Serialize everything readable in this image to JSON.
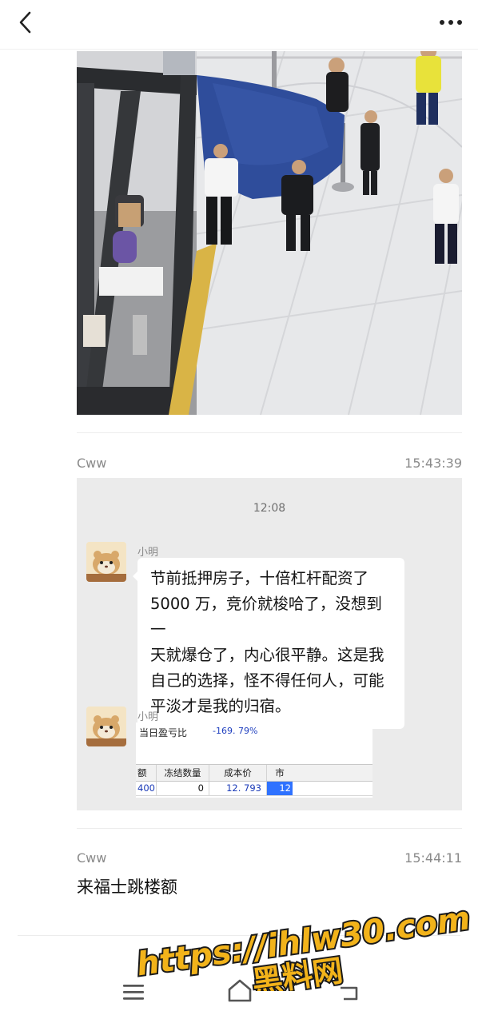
{
  "icons": {
    "back": "chevron-left-icon",
    "more": "more-horizontal-icon",
    "nav_menu": "menu-icon",
    "nav_home": "home-icon",
    "nav_back": "back-icon"
  },
  "messages": [
    {
      "sender": "Cww",
      "time": "15:43:39"
    },
    {
      "sender": "Cww",
      "time": "15:44:11",
      "text": "来福士跳楼额"
    }
  ],
  "chat_screenshot": {
    "time": "12:08",
    "sender": "小明",
    "bubble_lines": [
      "节前抵押房子，十倍杠杆配资了",
      "5000 万，竞价就梭哈了，没想到一",
      "天就爆仓了，内心很平静。这是我",
      "自己的选择，怪不得任何人，可能",
      "平淡才是我的归宿。"
    ],
    "second_sender": "小明",
    "table": {
      "pl_label": "当日盈亏比",
      "pl_value": "-169. 79%",
      "headers": [
        "额",
        "冻结数量",
        "成本价",
        "市"
      ],
      "row": [
        "400",
        "0",
        "12. 793",
        "12"
      ]
    }
  },
  "watermark": {
    "url": "https://ihlw30.com",
    "name": "黑料网",
    "color": "#f2b31a"
  }
}
